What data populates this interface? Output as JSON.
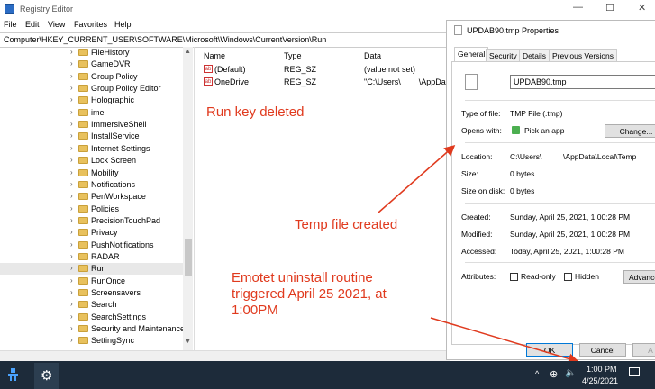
{
  "registry": {
    "title": "Registry Editor",
    "menu": [
      "File",
      "Edit",
      "View",
      "Favorites",
      "Help"
    ],
    "address": "Computer\\HKEY_CURRENT_USER\\SOFTWARE\\Microsoft\\Windows\\CurrentVersion\\Run",
    "tree_items": [
      "FileHistory",
      "GameDVR",
      "Group Policy",
      "Group Policy Editor",
      "Holographic",
      "ime",
      "ImmersiveShell",
      "InstallService",
      "Internet Settings",
      "Lock Screen",
      "Mobility",
      "Notifications",
      "PenWorkspace",
      "Policies",
      "PrecisionTouchPad",
      "Privacy",
      "PushNotifications",
      "RADAR",
      "Run",
      "RunOnce",
      "Screensavers",
      "Search",
      "SearchSettings",
      "Security and Maintenance",
      "SettingSync"
    ],
    "selected_item": "Run",
    "columns": {
      "name": "Name",
      "type": "Type",
      "data": "Data"
    },
    "rows": [
      {
        "name": "(Default)",
        "type": "REG_SZ",
        "data": "(value not set)"
      },
      {
        "name": "OneDrive",
        "type": "REG_SZ",
        "data": "\"C:\\Users\\        \\AppDa"
      }
    ]
  },
  "annotations": {
    "run_key": "Run key deleted",
    "temp_file": "Temp file created",
    "emotet": [
      "Emotet uninstall routine",
      "triggered April 25 2021, at",
      "1:00PM"
    ]
  },
  "dialog": {
    "title": "UPDAB90.tmp Properties",
    "tabs": [
      "General",
      "Security",
      "Details",
      "Previous Versions"
    ],
    "active_tab": "General",
    "filename": "UPDAB90.tmp",
    "type_label": "Type of file:",
    "type_value": "TMP File (.tmp)",
    "opens_label": "Opens with:",
    "opens_value": "Pick an app",
    "change_button": "Change...",
    "location_label": "Location:",
    "location_value": "C:\\Users\\          \\AppData\\Local\\Temp",
    "size_label": "Size:",
    "size_value": "0 bytes",
    "size_disk_label": "Size on disk:",
    "size_disk_value": "0 bytes",
    "created_label": "Created:",
    "created_value": "Sunday, April 25, 2021, 1:00:28 PM",
    "modified_label": "Modified:",
    "modified_value": "Sunday, April 25, 2021, 1:00:28 PM",
    "accessed_label": "Accessed:",
    "accessed_value": "Today, April 25, 2021, 1:00:28 PM",
    "attributes_label": "Attributes:",
    "readonly_label": "Read-only",
    "hidden_label": "Hidden",
    "advanced_button": "Advance",
    "ok_button": "OK",
    "cancel_button": "Cancel",
    "apply_button": "A"
  },
  "taskbar": {
    "time": "1:00 PM",
    "date": "4/25/2021"
  },
  "colors": {
    "annotation": "#e03a1e",
    "taskbar": "#1d2b3a"
  }
}
